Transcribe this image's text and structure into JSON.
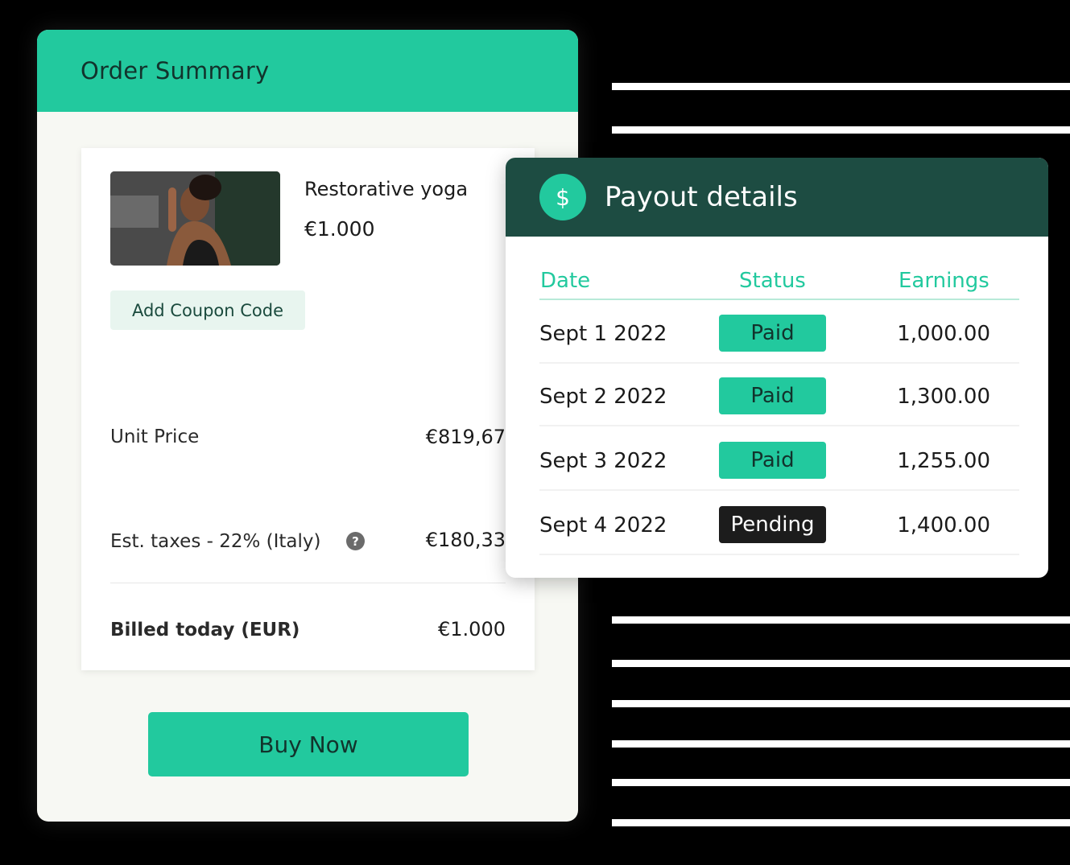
{
  "order": {
    "title": "Order Summary",
    "product": {
      "image_alt": "yoga-photo",
      "name": "Restorative yoga",
      "price": "€1.000"
    },
    "coupon_label": "Add Coupon Code",
    "unit_price_label": "Unit Price",
    "unit_price_value": "€819,67",
    "taxes_label": "Est. taxes - 22% (Italy)",
    "taxes_value": "€180,33",
    "help_icon": "?",
    "billed_label": "Billed today (EUR)",
    "billed_value": "€1.000",
    "buy_label": "Buy Now"
  },
  "payout": {
    "icon": "$",
    "title": "Payout details",
    "columns": [
      "Date",
      "Status",
      "Earnings"
    ],
    "rows": [
      {
        "date": "Sept 1 2022",
        "status": "Paid",
        "earnings": "1,000.00"
      },
      {
        "date": "Sept 2 2022",
        "status": "Paid",
        "earnings": "1,300.00"
      },
      {
        "date": "Sept 3 2022",
        "status": "Paid",
        "earnings": "1,255.00"
      },
      {
        "date": "Sept 4 2022",
        "status": "Pending",
        "earnings": "1,400.00"
      }
    ]
  },
  "colors": {
    "accent": "#22c99e",
    "payout_header": "#1d4c42",
    "pending": "#1c1c1c"
  }
}
